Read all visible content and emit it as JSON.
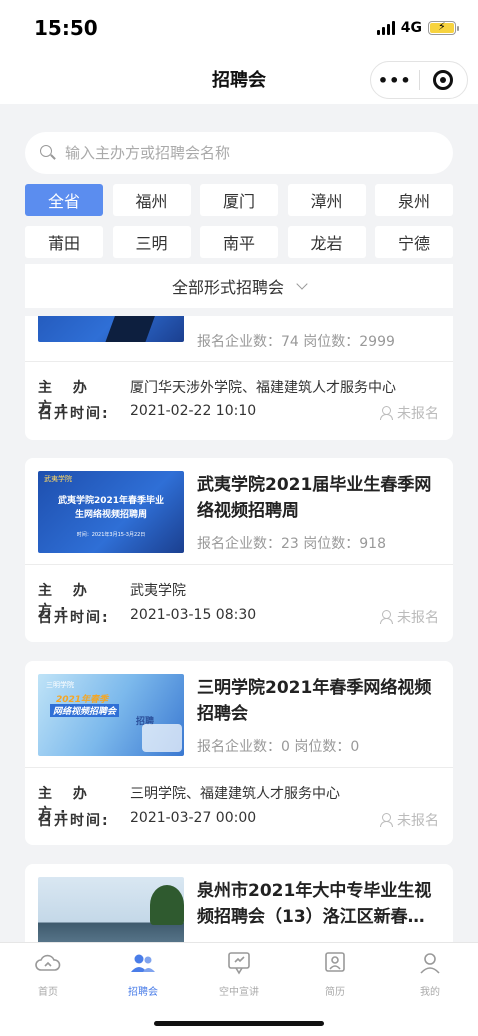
{
  "status": {
    "time": "15:50",
    "network": "4G"
  },
  "nav": {
    "title": "招聘会",
    "more": "•••"
  },
  "search": {
    "placeholder": "输入主办方或招聘会名称"
  },
  "cities": [
    "全省",
    "福州",
    "厦门",
    "漳州",
    "泉州",
    "莆田",
    "三明",
    "南平",
    "龙岩",
    "宁德"
  ],
  "active_city": "全省",
  "filter": {
    "label": "全部形式招聘会"
  },
  "labels": {
    "host": "主 办 方:",
    "time": "召开时间:",
    "not_registered": "未报名"
  },
  "fairs": [
    {
      "title": "",
      "stats": "报名企业数：74 岗位数：2999",
      "host": "厦门华天涉外学院、福建建筑人才服务中心",
      "time": "2021-02-22 10:10",
      "status": "未报名"
    },
    {
      "title": "武夷学院2021届毕业生春季网络视频招聘周",
      "stats": "报名企业数：23 岗位数：918",
      "host": "武夷学院",
      "time": "2021-03-15 08:30",
      "status": "未报名",
      "thumb_text": {
        "school": "武夷学院",
        "line1": "武夷学院2021年春季毕业",
        "line2": "生网络视频招聘周",
        "date": "时间：2021年3月15-3月22日"
      }
    },
    {
      "title": "三明学院2021年春季网络视频招聘会",
      "stats": "报名企业数：0 岗位数：0",
      "host": "三明学院、福建建筑人才服务中心",
      "time": "2021-03-27 00:00",
      "status": "未报名",
      "thumb_text": {
        "school": "三明学院",
        "line1": "2021年春季",
        "line2": "网络视频招聘会",
        "tag": "招聘"
      }
    },
    {
      "title": "泉州市2021年大中专毕业生视频招聘会（13）洛江区新春…"
    }
  ],
  "tabs": [
    {
      "label": "首页",
      "icon": "cloud-home-icon"
    },
    {
      "label": "招聘会",
      "icon": "people-icon"
    },
    {
      "label": "空中宣讲",
      "icon": "speech-icon"
    },
    {
      "label": "简历",
      "icon": "resume-icon"
    },
    {
      "label": "我的",
      "icon": "user-icon"
    }
  ],
  "active_tab": "招聘会",
  "colors": {
    "accent": "#5b8def",
    "tab_active": "#4a7de8",
    "muted": "#999999"
  }
}
